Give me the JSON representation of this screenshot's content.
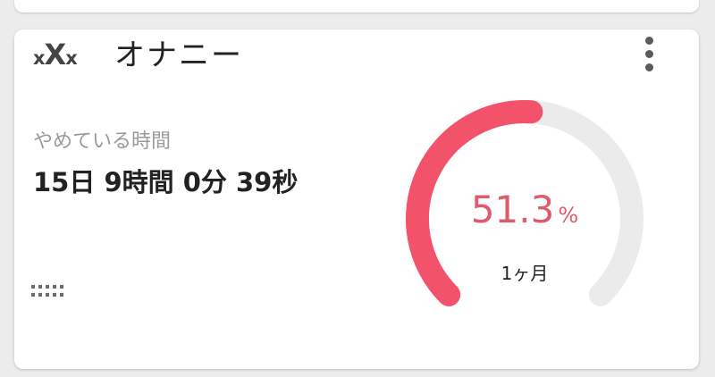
{
  "card": {
    "logo_text_left": "x",
    "logo_text_mid": "X",
    "logo_text_right": "x",
    "title": "オナニー",
    "menu_icon": "more-vertical-icon",
    "elapsed_label": "やめている時間",
    "elapsed_value": "15日 9時間 0分 39秒",
    "drag_icon": "drag-handle-icon"
  },
  "gauge": {
    "percent_value": "51.3",
    "percent_sign": "%",
    "period_label": "1ヶ月",
    "fraction": 0.513,
    "progress_color": "#f2526a",
    "track_color": "#ebebeb",
    "text_color": "#e05a6c"
  },
  "colors": {
    "background": "#ececec",
    "card": "#ffffff",
    "text": "#222222",
    "muted": "#9a9a9a"
  }
}
